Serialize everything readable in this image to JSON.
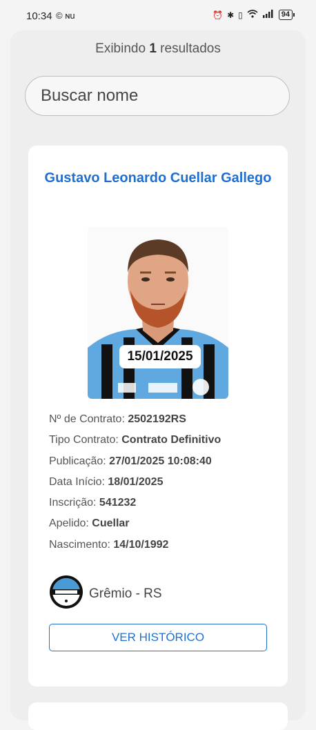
{
  "status_bar": {
    "time": "10:34",
    "left_icons": "© ɴu",
    "battery": "94"
  },
  "results": {
    "prefix": "Exibindo",
    "count": "1",
    "suffix": "resultados"
  },
  "search": {
    "placeholder": "Buscar nome"
  },
  "card": {
    "name": "Gustavo Leonardo Cuellar Gallego",
    "photo_date": "15/01/2025",
    "fields": [
      {
        "label": "Nº de Contrato:",
        "value": "2502192RS"
      },
      {
        "label": "Tipo Contrato:",
        "value": "Contrato Definitivo"
      },
      {
        "label": "Publicação:",
        "value": "27/01/2025 10:08:40"
      },
      {
        "label": "Data Início:",
        "value": "18/01/2025"
      },
      {
        "label": "Inscrição:",
        "value": "541232"
      },
      {
        "label": "Apelido:",
        "value": "Cuellar"
      },
      {
        "label": "Nascimento:",
        "value": "14/10/1992"
      }
    ],
    "club": "Grêmio - RS",
    "history_button": "VER HISTÓRICO"
  },
  "colors": {
    "accent": "#1f6fd1",
    "background": "#f4f4f4"
  }
}
